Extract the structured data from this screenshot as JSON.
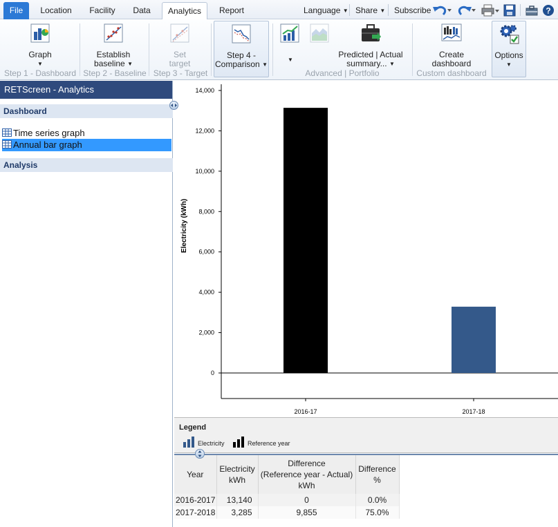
{
  "menu": {
    "tabs": [
      "File",
      "Location",
      "Facility",
      "Data",
      "Analytics",
      "Report"
    ],
    "language": "Language",
    "share": "Share",
    "subscribe": "Subscribe"
  },
  "ribbon": {
    "graph": "Graph",
    "establish_baseline_1": "Establish",
    "establish_baseline_2": "baseline",
    "set_target_1": "Set",
    "set_target_2": "target",
    "step4_1": "Step 4 -",
    "step4_2": "Comparison",
    "predicted_1": "Predicted | Actual",
    "predicted_2": "summary...",
    "create_dashboard_1": "Create",
    "create_dashboard_2": "dashboard",
    "options": "Options",
    "groups": {
      "step1": "Step 1 - Dashboard",
      "step2": "Step 2 - Baseline",
      "step3": "Step 3 - Target",
      "advanced": "Advanced | Portfolio",
      "custom": "Custom dashboard"
    }
  },
  "left_panel": {
    "title": "RETScreen - Analytics",
    "sections": [
      {
        "label": "Dashboard",
        "items": [
          "Time series graph",
          "Annual bar graph"
        ]
      },
      {
        "label": "Analysis",
        "items": []
      }
    ],
    "selected_item": "Annual bar graph"
  },
  "chart_data": {
    "type": "bar",
    "categories": [
      "2016-17",
      "2017-18"
    ],
    "values": [
      13140,
      3285
    ],
    "colors": [
      "#000000",
      "#34598a"
    ],
    "ylabel": "Electricity (kWh)",
    "xlabel": "",
    "ylim": [
      0,
      14000
    ],
    "yticks": [
      0,
      2000,
      4000,
      6000,
      8000,
      10000,
      12000,
      14000
    ],
    "ytick_labels": [
      "0",
      "2,000",
      "4,000",
      "6,000",
      "8,000",
      "10,000",
      "12,000",
      "14,000"
    ],
    "grid": false
  },
  "legend": {
    "title": "Legend",
    "items": [
      {
        "label": "Electricity",
        "color": "#34598a"
      },
      {
        "label": "Reference year",
        "color": "#000000"
      }
    ]
  },
  "table": {
    "headers": [
      [
        "Year"
      ],
      [
        "Electricity",
        "kWh"
      ],
      [
        "Difference",
        "(Reference year - Actual)",
        "kWh"
      ],
      [
        "Difference",
        "%"
      ]
    ],
    "rows": [
      [
        "2016-2017",
        "13,140",
        "0",
        "0.0%"
      ],
      [
        "2017-2018",
        "3,285",
        "9,855",
        "75.0%"
      ]
    ]
  }
}
